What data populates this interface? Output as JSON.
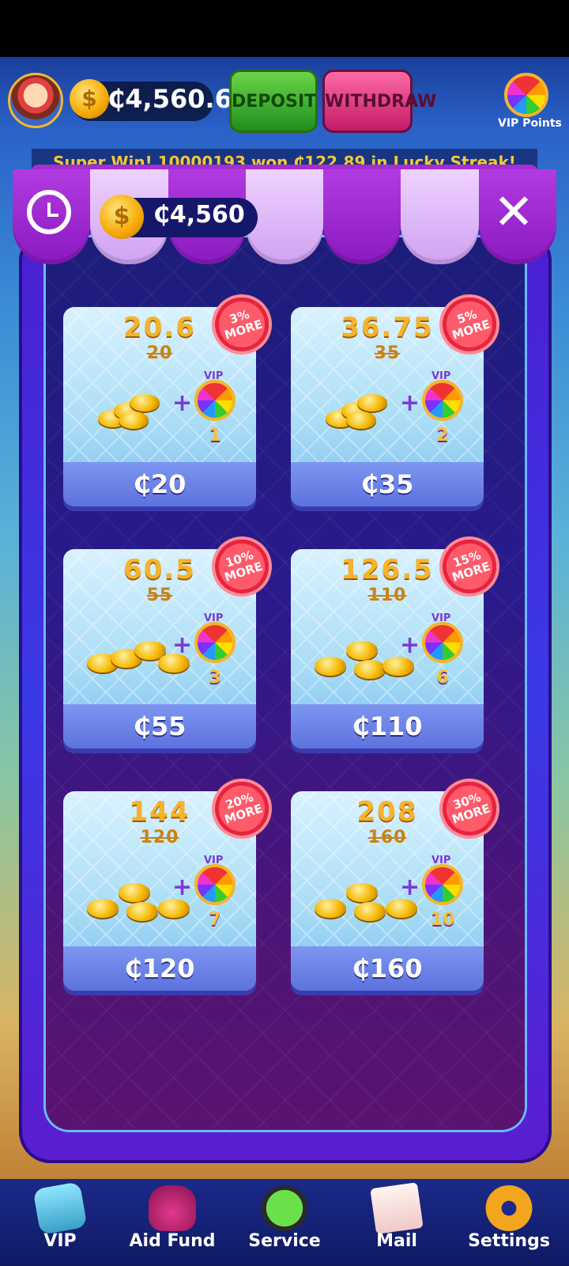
{
  "topbar": {
    "balance": "₵4,560.6",
    "deposit_label": "DEPOSIT",
    "withdraw_label": "WITHDRAW",
    "vip_points_label": "VIP Points"
  },
  "ticker": {
    "text": "Super Win! 10000193 won ₵122.89 in Lucky Streak!"
  },
  "panel": {
    "balance": "₵4,560",
    "close_glyph": "✕"
  },
  "currency_glyph": "$",
  "cards": [
    {
      "amount": "20.6",
      "old": "20",
      "badge_pct": "3%",
      "badge_word": "MORE",
      "vip_tag": "VIP",
      "vip_count": "1",
      "price": "₵20"
    },
    {
      "amount": "36.75",
      "old": "35",
      "badge_pct": "5%",
      "badge_word": "MORE",
      "vip_tag": "VIP",
      "vip_count": "2",
      "price": "₵35"
    },
    {
      "amount": "60.5",
      "old": "55",
      "badge_pct": "10%",
      "badge_word": "MORE",
      "vip_tag": "VIP",
      "vip_count": "3",
      "price": "₵55"
    },
    {
      "amount": "126.5",
      "old": "110",
      "badge_pct": "15%",
      "badge_word": "MORE",
      "vip_tag": "VIP",
      "vip_count": "6",
      "price": "₵110"
    },
    {
      "amount": "144",
      "old": "120",
      "badge_pct": "20%",
      "badge_word": "MORE",
      "vip_tag": "VIP",
      "vip_count": "7",
      "price": "₵120"
    },
    {
      "amount": "208",
      "old": "160",
      "badge_pct": "30%",
      "badge_word": "MORE",
      "vip_tag": "VIP",
      "vip_count": "10",
      "price": "₵160"
    }
  ],
  "plus": "+",
  "bottom_nav": [
    {
      "label": "VIP",
      "icon": "vip-icon"
    },
    {
      "label": "Aid Fund",
      "icon": "moneybag-icon"
    },
    {
      "label": "Service",
      "icon": "headset-icon"
    },
    {
      "label": "Mail",
      "icon": "mail-icon"
    },
    {
      "label": "Settings",
      "icon": "gear-icon"
    }
  ],
  "colors": {
    "panel": "#3a39e6",
    "badge": "#e6243e",
    "gold": "#f6b32a",
    "price_bar": "#5d72de"
  }
}
